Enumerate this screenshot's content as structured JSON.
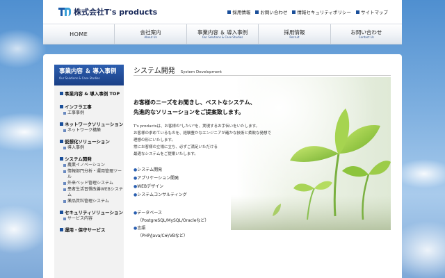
{
  "header": {
    "logo_text": "株式会社T's products",
    "utility_links": [
      "採用情報",
      "お問い合わせ",
      "情報セキュリティポリシー",
      "サイトマップ"
    ]
  },
  "nav": [
    {
      "jp": "HOME",
      "en": ""
    },
    {
      "jp": "会社案内",
      "en": "About Us"
    },
    {
      "jp": "事業内容 ＆ 導入事例",
      "en": "Our Solutions & Case Studies"
    },
    {
      "jp": "採用情報",
      "en": "Recruit"
    },
    {
      "jp": "お問い合わせ",
      "en": "Contact Us"
    }
  ],
  "sidebar": {
    "title": "事業内容 ＆ 導入事例",
    "subtitle": "Our Solutions & Case Studies",
    "top_item": "事業内容 & 導入事例 TOP",
    "categories": [
      {
        "label": "インフラ工事",
        "items": [
          "工事事例"
        ]
      },
      {
        "label": "ネットワークソリューション",
        "items": [
          "ネットワーク構築"
        ]
      },
      {
        "label": "仮想化ソリューション",
        "items": [
          "導入事例"
        ]
      },
      {
        "label": "システム開発",
        "items": [
          "農業イノベーション",
          "情報部門分析・運用管理ツール",
          "外来ベッド管理システム",
          "患者生活習慣改善WEBシステム",
          "薬品資料管理システム"
        ]
      },
      {
        "label": "セキュリティソリューション",
        "items": [
          "サービス内容"
        ]
      },
      {
        "label": "運用・保守サービス",
        "items": []
      }
    ]
  },
  "main": {
    "title": "システム開発",
    "title_en": "System Development",
    "headline_1": "お客様のニーズをお聞きし、ベストなシステム、",
    "headline_2": "先進的なソリューションをご提案致します。",
    "desc": [
      "T's productsは、お客様の\"したい\"を、実現するお手伝いをいたします。",
      "お客様の求めているものを、経験豊かなエンジニアが確かな技術と柔軟な発想で",
      "理想の形にいたします。",
      "常にお客様の立場に立ち、必ずご満足いただける",
      "最適なシステムをご提案いたします。"
    ],
    "services": [
      "システム開発",
      "アプリケーション開発",
      "WEBデザイン",
      "システムコンサルティング"
    ],
    "tech": [
      {
        "label": "データベース",
        "detail": "（PostgreSQL/MySQL/Oracleなど）"
      },
      {
        "label": "言語",
        "detail": "（PHP/Java/C#/VBなど）"
      }
    ]
  },
  "colors": {
    "brand_blue": "#1a4f9a",
    "sidebar_head": "#2d5fb0"
  }
}
